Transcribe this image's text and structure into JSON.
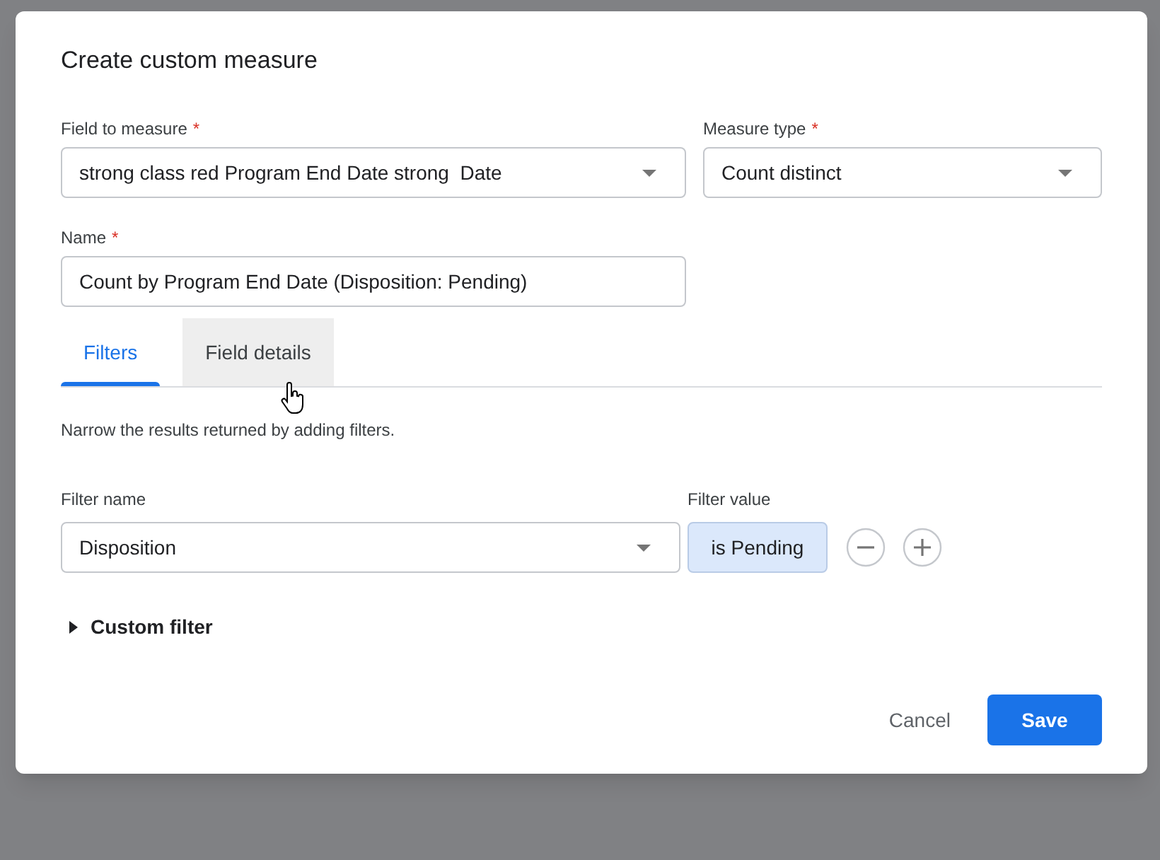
{
  "dialog": {
    "title": "Create custom measure",
    "fields": [
      {
        "label": "Field to measure",
        "required_mark": "*",
        "kind": "select",
        "value": "strong class red Program End Date strong  Date"
      },
      {
        "label": "Measure type",
        "required_mark": "*",
        "kind": "select",
        "value": "Count distinct"
      },
      {
        "label": "Name",
        "required_mark": "*",
        "kind": "text",
        "value": "Count by Program End Date (Disposition: Pending)"
      }
    ],
    "tabs": [
      {
        "label": "Filters",
        "selected": true,
        "hovered": false
      },
      {
        "label": "Field details",
        "selected": false,
        "hovered": true
      }
    ],
    "description": "Narrow the results returned by adding filters.",
    "filter": {
      "name_label": "Filter name",
      "value_label": "Filter value",
      "name": "Disposition",
      "value": "is Pending"
    },
    "custom_filter": {
      "label": "Custom filter",
      "expanded": false
    },
    "buttons": [
      {
        "label": "Cancel",
        "kind": "text"
      },
      {
        "label": "Save",
        "kind": "primary"
      }
    ]
  }
}
